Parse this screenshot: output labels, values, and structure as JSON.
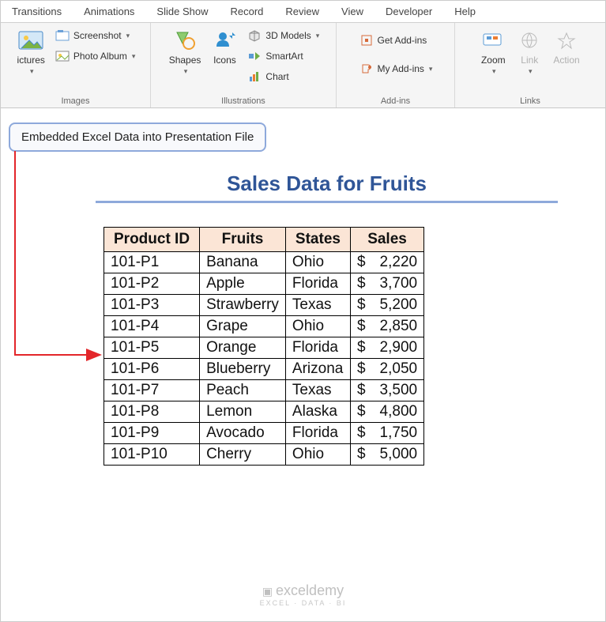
{
  "tabs": [
    "Transitions",
    "Animations",
    "Slide Show",
    "Record",
    "Review",
    "View",
    "Developer",
    "Help"
  ],
  "ribbon": {
    "images": {
      "label": "Images",
      "pictures": "ictures",
      "screenshot": "Screenshot",
      "photoalbum": "Photo Album"
    },
    "illustrations": {
      "label": "Illustrations",
      "shapes": "Shapes",
      "icons": "Icons",
      "models": "3D Models",
      "smartart": "SmartArt",
      "chart": "Chart"
    },
    "addins": {
      "label": "Add-ins",
      "get": "Get Add-ins",
      "my": "My Add-ins"
    },
    "links": {
      "label": "Links",
      "zoom": "Zoom",
      "link": "Link",
      "action": "Action"
    }
  },
  "callout": "Embedded Excel Data into Presentation File",
  "title": "Sales Data for Fruits",
  "headers": [
    "Product ID",
    "Fruits",
    "States",
    "Sales"
  ],
  "rows": [
    {
      "id": "101-P1",
      "fruit": "Banana",
      "state": "Ohio",
      "cur": "$",
      "sale": "2,220"
    },
    {
      "id": "101-P2",
      "fruit": "Apple",
      "state": "Florida",
      "cur": "$",
      "sale": "3,700"
    },
    {
      "id": "101-P3",
      "fruit": "Strawberry",
      "state": "Texas",
      "cur": "$",
      "sale": "5,200"
    },
    {
      "id": "101-P4",
      "fruit": "Grape",
      "state": "Ohio",
      "cur": "$",
      "sale": "2,850"
    },
    {
      "id": "101-P5",
      "fruit": "Orange",
      "state": "Florida",
      "cur": "$",
      "sale": "2,900"
    },
    {
      "id": "101-P6",
      "fruit": "Blueberry",
      "state": "Arizona",
      "cur": "$",
      "sale": "2,050"
    },
    {
      "id": "101-P7",
      "fruit": "Peach",
      "state": "Texas",
      "cur": "$",
      "sale": "3,500"
    },
    {
      "id": "101-P8",
      "fruit": "Lemon",
      "state": "Alaska",
      "cur": "$",
      "sale": "4,800"
    },
    {
      "id": "101-P9",
      "fruit": "Avocado",
      "state": "Florida",
      "cur": "$",
      "sale": "1,750"
    },
    {
      "id": "101-P10",
      "fruit": "Cherry",
      "state": "Ohio",
      "cur": "$",
      "sale": "5,000"
    }
  ],
  "watermark": {
    "main": "exceldemy",
    "sub": "EXCEL · DATA · BI"
  }
}
